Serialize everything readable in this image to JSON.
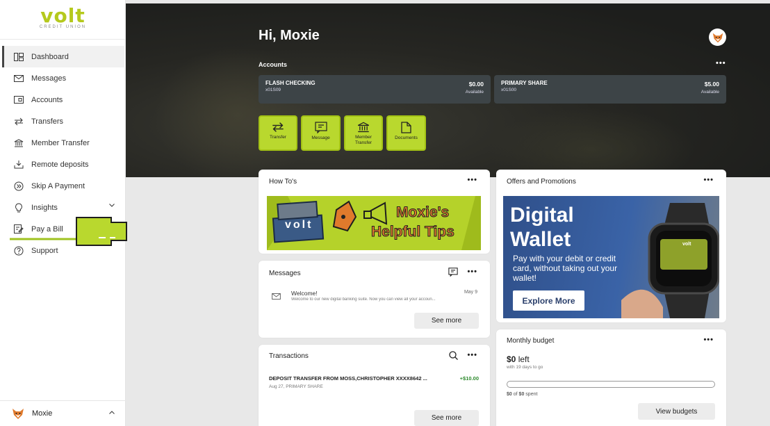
{
  "brand": {
    "logo_word": "volt",
    "logo_sub": "CREDIT UNION",
    "accent": "#b9d82e",
    "sidebar_active": "#444444"
  },
  "sidebar": {
    "items": [
      {
        "label": "Dashboard",
        "icon": "dashboard-icon",
        "active": true
      },
      {
        "label": "Messages",
        "icon": "envelope-icon"
      },
      {
        "label": "Accounts",
        "icon": "accounts-icon"
      },
      {
        "label": "Transfers",
        "icon": "transfer-arrows-icon"
      },
      {
        "label": "Member Transfer",
        "icon": "bank-icon"
      },
      {
        "label": "Remote deposits",
        "icon": "deposit-icon"
      },
      {
        "label": "Skip A Payment",
        "icon": "skip-icon"
      },
      {
        "label": "Insights",
        "icon": "lightbulb-icon",
        "expandable": true
      },
      {
        "label": "Pay a Bill",
        "icon": "bill-icon"
      },
      {
        "label": "Support",
        "icon": "help-icon"
      }
    ],
    "user": {
      "name": "Moxie",
      "icon": "fox-avatar-icon"
    }
  },
  "hero": {
    "greeting": "Hi, Moxie",
    "accounts_label": "Accounts",
    "accounts": [
      {
        "name": "FLASH CHECKING",
        "number": "x01S09",
        "amount": "$0.00",
        "status": "Available"
      },
      {
        "name": "PRIMARY SHARE",
        "number": "x01S00",
        "amount": "$5.00",
        "status": "Available"
      }
    ],
    "quick_actions": [
      {
        "label": "Transfer",
        "icon": "transfer-arrows-icon"
      },
      {
        "label": "Message",
        "icon": "message-icon"
      },
      {
        "label": "Member Transfer",
        "icon": "bank-icon"
      },
      {
        "label": "Documents",
        "icon": "document-icon"
      }
    ]
  },
  "howto": {
    "title": "How To's",
    "banner_brand": "volt",
    "banner_text_1": "Moxie's",
    "banner_text_2": "Helpful Tips"
  },
  "offers": {
    "title": "Offers and Promotions",
    "headline_1": "Digital",
    "headline_2": "Wallet",
    "body": "Pay with your debit or credit card, without taking out your wallet!",
    "cta": "Explore More",
    "card_brand": "volt"
  },
  "messages": {
    "title": "Messages",
    "items": [
      {
        "title": "Welcome!",
        "body": "Welcome to our new digital banking suite. Now you can view all your accoun...",
        "date": "May 9"
      }
    ],
    "see_more": "See more"
  },
  "transactions": {
    "title": "Transactions",
    "items": [
      {
        "desc": "DEPOSIT TRANSFER FROM MOSS,CHRISTOPHER XXXX8642 ...",
        "meta": "Aug 27, PRIMARY SHARE",
        "amount": "+$10.00"
      }
    ],
    "see_more": "See more"
  },
  "budget": {
    "title": "Monthly budget",
    "left_amount": "$0",
    "left_word": "left",
    "days": "with 19 days to go",
    "spent": "$0",
    "of_word": "of",
    "total": "$0",
    "spent_word": "spent",
    "progress": 0,
    "cta": "View budgets"
  },
  "more_label": "•••"
}
